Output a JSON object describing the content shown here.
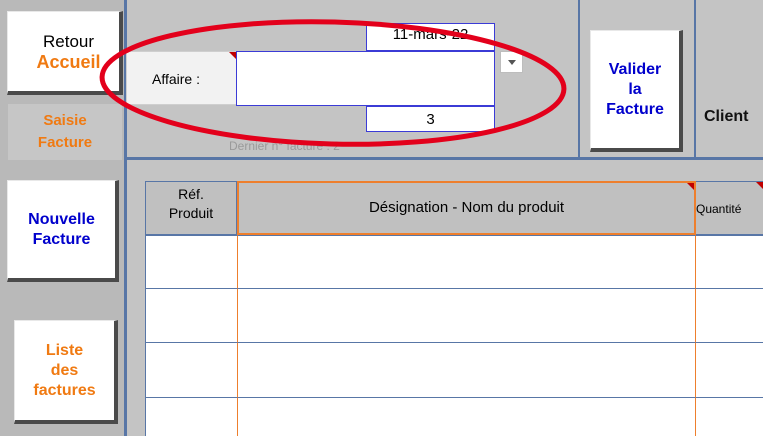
{
  "sidebar": {
    "retour_line1": "Retour",
    "retour_line2": "Accueil",
    "saisie_line1": "Saisie",
    "saisie_line2": "Facture",
    "nouvelle_line1": "Nouvelle",
    "nouvelle_line2": "Facture",
    "liste_line1": "Liste",
    "liste_line2": "des",
    "liste_line3": "factures"
  },
  "header": {
    "date_value": "11-mars-22",
    "affaire_label": "Affaire :",
    "affaire_value": "",
    "facture_number": "3",
    "dernier_facture": "Dernier n° facture : 2",
    "valider_line1": "Valider",
    "valider_line2": "la",
    "valider_line3": "Facture",
    "client_label": "Client"
  },
  "table": {
    "columns": [
      {
        "line1": "Réf.",
        "line2": "Produit"
      },
      {
        "label": "Désignation - Nom du produit"
      },
      {
        "label": "Quantité"
      }
    ],
    "rows": [
      {
        "ref": "",
        "designation": "",
        "quantite": ""
      },
      {
        "ref": "",
        "designation": "",
        "quantite": ""
      },
      {
        "ref": "",
        "designation": "",
        "quantite": ""
      },
      {
        "ref": "",
        "designation": "",
        "quantite": ""
      }
    ]
  },
  "colors": {
    "orange_accent": "#f07a12",
    "blue_text": "#0000cc",
    "annotation_red": "#e3001b",
    "grid_blue": "#5876a6"
  }
}
